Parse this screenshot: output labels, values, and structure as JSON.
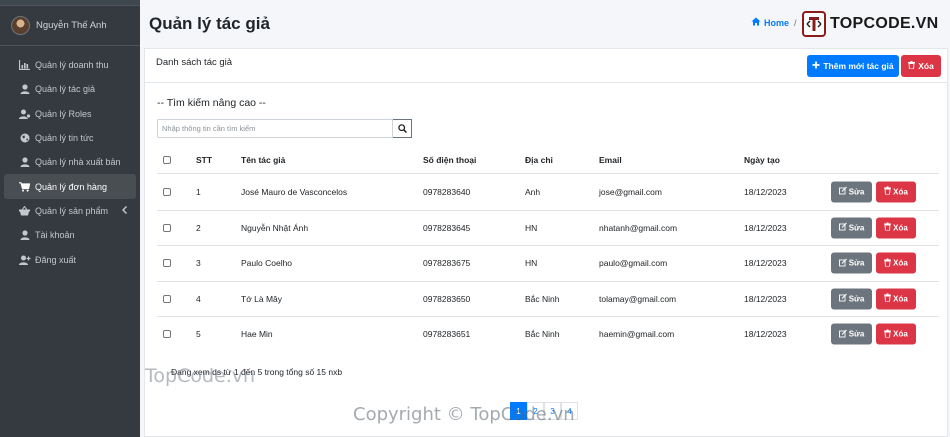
{
  "sidebar": {
    "user_name": "Nguyễn Thế Anh",
    "items": [
      {
        "label": "Quản lý doanh thu",
        "icon": "chart-icon"
      },
      {
        "label": "Quản lý tác giả",
        "icon": "user-icon"
      },
      {
        "label": "Quản lý Roles",
        "icon": "users-cog-icon"
      },
      {
        "label": "Quản lý tin tức",
        "icon": "globe-icon"
      },
      {
        "label": "Quản lý nhà xuất bản",
        "icon": "user-icon"
      },
      {
        "label": "Quản lý đơn hàng",
        "icon": "cart-icon",
        "active": true
      },
      {
        "label": "Quản lý sản phẩm",
        "icon": "basket-icon",
        "has_submenu": true
      },
      {
        "label": "Tài khoản",
        "icon": "user-icon"
      },
      {
        "label": "Đăng xuất",
        "icon": "user-plus-icon"
      }
    ]
  },
  "header": {
    "title": "Quản lý tác giả",
    "breadcrumb_home": "Home",
    "breadcrumb_sep": "/"
  },
  "card": {
    "title": "Danh sách tác giả",
    "add_label": "Thêm mới tác giả",
    "delete_label": "Xóa"
  },
  "search": {
    "heading": "-- Tìm kiếm nâng cao --",
    "placeholder": "Nhập thông tin cần tìm kiếm"
  },
  "table": {
    "headers": {
      "stt": "STT",
      "name": "Tên tác giả",
      "phone": "Số điện thoại",
      "address": "Địa chỉ",
      "email": "Email",
      "date": "Ngày tạo"
    },
    "edit_label": "Sửa",
    "delete_label": "Xóa",
    "rows": [
      {
        "stt": "1",
        "name": "José Mauro de Vasconcelos",
        "phone": "0978283640",
        "address": "Anh",
        "email": "jose@gmail.com",
        "date": "18/12/2023"
      },
      {
        "stt": "2",
        "name": "Nguyễn Nhật Ánh",
        "phone": "0978283645",
        "address": "HN",
        "email": "nhatanh@gmail.com",
        "date": "18/12/2023"
      },
      {
        "stt": "3",
        "name": "Paulo Coelho",
        "phone": "0978283675",
        "address": "HN",
        "email": "paulo@gmail.com",
        "date": "18/12/2023"
      },
      {
        "stt": "4",
        "name": "Tớ Là Mây",
        "phone": "0978283650",
        "address": "Bắc Ninh",
        "email": "tolamay@gmail.com",
        "date": "18/12/2023"
      },
      {
        "stt": "5",
        "name": "Hae Min",
        "phone": "0978283651",
        "address": "Bắc Ninh",
        "email": "haemin@gmail.com",
        "date": "18/12/2023"
      }
    ]
  },
  "footer": {
    "summary": "Đang xem ds từ 1 đến 5 trong tổng số 15 nxb",
    "pages": [
      "1",
      "2",
      "3",
      "4"
    ]
  },
  "watermarks": {
    "logo": "TOPCODE.VN",
    "mid": "TopCode.vn",
    "bottom": "Copyright © TopCode.vn"
  },
  "colors": {
    "primary": "#007bff",
    "danger": "#dc3545",
    "secondary": "#6c757d",
    "sidebar": "#343a40"
  }
}
